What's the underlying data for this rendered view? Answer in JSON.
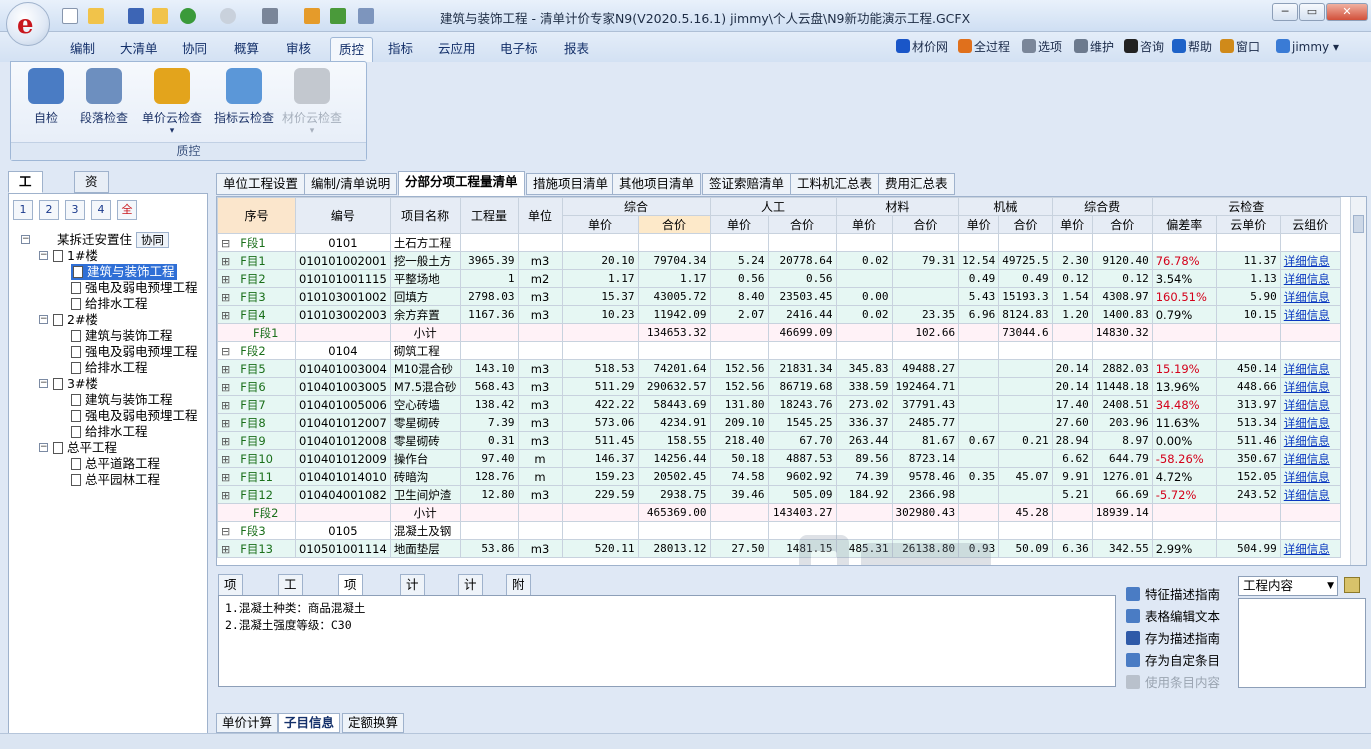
{
  "window": {
    "title": "建筑与装饰工程 - 清单计价专家N9(V2020.5.16.1) jimmy\\个人云盘\\N9新功能演示工程.GCFX",
    "logo_text": "e",
    "min": "─",
    "max": "▭",
    "close": "✕"
  },
  "menu": {
    "tabs": [
      "编制",
      "大清单",
      "协同",
      "概算",
      "审核",
      "质控",
      "指标",
      "云应用",
      "电子标",
      "报表"
    ],
    "active": "质控",
    "right_tools": [
      {
        "label": "材价网",
        "icon": "material-price-icon",
        "color": "#1a56c8"
      },
      {
        "label": "全过程",
        "icon": "full-process-icon",
        "color": "#e0701c"
      },
      {
        "label": "选项",
        "icon": "gear-icon",
        "color": "#7a8699"
      },
      {
        "label": "维护",
        "icon": "wrench-icon",
        "color": "#6c7a8e"
      },
      {
        "label": "咨询",
        "icon": "qq-icon",
        "color": "#222222"
      },
      {
        "label": "帮助",
        "icon": "help-icon",
        "color": "#1e62c8"
      },
      {
        "label": "窗口",
        "icon": "window-icon",
        "color": "#d08a1a"
      },
      {
        "label": "jimmy ▾",
        "icon": "user-icon",
        "color": "#3a7bd5"
      }
    ]
  },
  "ribbon": {
    "group": "质控",
    "buttons": [
      {
        "label": "自检",
        "icon": "target-icon",
        "color": "#4a7cc4",
        "disabled": false
      },
      {
        "label": "段落检查",
        "icon": "doc-check-icon",
        "color": "#6d8fbf",
        "disabled": false
      },
      {
        "label": "单价云检查",
        "icon": "yen-icon",
        "color": "#e3a41c",
        "disabled": false,
        "dropdown": "▾"
      },
      {
        "label": "指标云检查",
        "icon": "cloud-icon",
        "color": "#5b97d8",
        "disabled": false
      },
      {
        "label": "材价云检查",
        "icon": "bars-icon",
        "color": "#c3c8cf",
        "disabled": true,
        "dropdown": "▾"
      }
    ]
  },
  "left": {
    "tabs": [
      "工程树",
      "资料库"
    ],
    "levels": [
      "1",
      "2",
      "3",
      "4",
      "全"
    ],
    "root": {
      "label": "某拆迁安置住",
      "badge": "协同"
    },
    "tree": [
      {
        "label": "1#楼",
        "level": 1,
        "expanded": true
      },
      {
        "label": "建筑与装饰工程",
        "level": 2,
        "selected": true
      },
      {
        "label": "强电及弱电预埋工程",
        "level": 2
      },
      {
        "label": "给排水工程",
        "level": 2
      },
      {
        "label": "2#楼",
        "level": 1,
        "expanded": true
      },
      {
        "label": "建筑与装饰工程",
        "level": 2
      },
      {
        "label": "强电及弱电预埋工程",
        "level": 2
      },
      {
        "label": "给排水工程",
        "level": 2
      },
      {
        "label": "3#楼",
        "level": 1,
        "expanded": true
      },
      {
        "label": "建筑与装饰工程",
        "level": 2
      },
      {
        "label": "强电及弱电预埋工程",
        "level": 2
      },
      {
        "label": "给排水工程",
        "level": 2
      },
      {
        "label": "总平工程",
        "level": 1,
        "expanded": true
      },
      {
        "label": "总平道路工程",
        "level": 2
      },
      {
        "label": "总平园林工程",
        "level": 2
      }
    ]
  },
  "right_tabs": [
    "单位工程设置",
    "编制/清单说明",
    "分部分项工程量清单",
    "措施项目清单",
    "其他项目清单",
    "签证索赔清单",
    "工料机汇总表",
    "费用汇总表"
  ],
  "right_tab_active": "分部分项工程量清单",
  "grid": {
    "headers_top": [
      "序号",
      "编号",
      "项目名称",
      "工程量",
      "单位",
      "综合",
      "人工",
      "材料",
      "机械",
      "综合费",
      "云检查"
    ],
    "headers_sub": [
      "单价",
      "合价",
      "单价",
      "合价",
      "单价",
      "合价",
      "单价",
      "合价",
      "单价",
      "合价",
      "偏差率",
      "云单价",
      "云组价"
    ],
    "rows": [
      {
        "type": "part",
        "seq": "F段1",
        "code": "0101",
        "name": "土石方工程"
      },
      {
        "type": "itm",
        "seq": "F目1",
        "code": "010101002001",
        "name": "挖一般土方",
        "qty": "3965.39",
        "unit": "m3",
        "zh_dj": "20.10",
        "zh_hj": "79704.34",
        "rg_dj": "5.24",
        "rg_hj": "20778.64",
        "cl_dj": "0.02",
        "cl_hj": "79.31",
        "jx_dj": "12.54",
        "jx_hj": "49725.5",
        "zf_dj": "2.30",
        "zf_hj": "9120.40",
        "dev": "76.78%",
        "dev_red": true,
        "cloud": "11.37",
        "link": "详细信息"
      },
      {
        "type": "itm",
        "seq": "F目2",
        "code": "010101001115",
        "name": "平整场地",
        "qty": "1",
        "unit": "m2",
        "zh_dj": "1.17",
        "zh_hj": "1.17",
        "rg_dj": "0.56",
        "rg_hj": "0.56",
        "cl_dj": "",
        "cl_hj": "",
        "jx_dj": "0.49",
        "jx_hj": "0.49",
        "zf_dj": "0.12",
        "zf_hj": "0.12",
        "dev": "3.54%",
        "cloud": "1.13",
        "link": "详细信息"
      },
      {
        "type": "itm",
        "seq": "F目3",
        "code": "010103001002",
        "name": "回填方",
        "qty": "2798.03",
        "unit": "m3",
        "zh_dj": "15.37",
        "zh_hj": "43005.72",
        "rg_dj": "8.40",
        "rg_hj": "23503.45",
        "cl_dj": "0.00",
        "cl_hj": "",
        "jx_dj": "5.43",
        "jx_hj": "15193.3",
        "zf_dj": "1.54",
        "zf_hj": "4308.97",
        "dev": "160.51%",
        "dev_red": true,
        "cloud": "5.90",
        "link": "详细信息"
      },
      {
        "type": "itm",
        "seq": "F目4",
        "code": "010103002003",
        "name": "余方弃置",
        "qty": "1167.36",
        "unit": "m3",
        "zh_dj": "10.23",
        "zh_hj": "11942.09",
        "rg_dj": "2.07",
        "rg_hj": "2416.44",
        "cl_dj": "0.02",
        "cl_hj": "23.35",
        "jx_dj": "6.96",
        "jx_hj": "8124.83",
        "zf_dj": "1.20",
        "zf_hj": "1400.83",
        "dev": "0.79%",
        "cloud": "10.15",
        "link": "详细信息"
      },
      {
        "type": "sub",
        "seq": "F段1",
        "name": "小计",
        "zh_hj": "134653.32",
        "rg_hj": "46699.09",
        "cl_hj": "102.66",
        "jx_hj": "73044.6",
        "zf_hj": "14830.32"
      },
      {
        "type": "part",
        "seq": "F段2",
        "code": "0104",
        "name": "砌筑工程"
      },
      {
        "type": "itm",
        "seq": "F目5",
        "code": "010401003004",
        "name": "M10混合砂",
        "qty": "143.10",
        "unit": "m3",
        "zh_dj": "518.53",
        "zh_hj": "74201.64",
        "rg_dj": "152.56",
        "rg_hj": "21831.34",
        "cl_dj": "345.83",
        "cl_hj": "49488.27",
        "jx_dj": "",
        "jx_hj": "",
        "zf_dj": "20.14",
        "zf_hj": "2882.03",
        "dev": "15.19%",
        "dev_red": true,
        "cloud": "450.14",
        "link": "详细信息"
      },
      {
        "type": "itm",
        "seq": "F目6",
        "code": "010401003005",
        "name": "M7.5混合砂",
        "qty": "568.43",
        "unit": "m3",
        "zh_dj": "511.29",
        "zh_hj": "290632.57",
        "rg_dj": "152.56",
        "rg_hj": "86719.68",
        "cl_dj": "338.59",
        "cl_hj": "192464.71",
        "jx_dj": "",
        "jx_hj": "",
        "zf_dj": "20.14",
        "zf_hj": "11448.18",
        "dev": "13.96%",
        "cloud": "448.66",
        "link": "详细信息"
      },
      {
        "type": "itm",
        "seq": "F目7",
        "code": "010401005006",
        "name": "空心砖墙",
        "qty": "138.42",
        "unit": "m3",
        "zh_dj": "422.22",
        "zh_hj": "58443.69",
        "rg_dj": "131.80",
        "rg_hj": "18243.76",
        "cl_dj": "273.02",
        "cl_hj": "37791.43",
        "jx_dj": "",
        "jx_hj": "",
        "zf_dj": "17.40",
        "zf_hj": "2408.51",
        "dev": "34.48%",
        "dev_red": true,
        "cloud": "313.97",
        "link": "详细信息"
      },
      {
        "type": "itm",
        "seq": "F目8",
        "code": "010401012007",
        "name": "零星砌砖",
        "qty": "7.39",
        "unit": "m3",
        "zh_dj": "573.06",
        "zh_hj": "4234.91",
        "rg_dj": "209.10",
        "rg_hj": "1545.25",
        "cl_dj": "336.37",
        "cl_hj": "2485.77",
        "jx_dj": "",
        "jx_hj": "",
        "zf_dj": "27.60",
        "zf_hj": "203.96",
        "dev": "11.63%",
        "cloud": "513.34",
        "link": "详细信息"
      },
      {
        "type": "itm",
        "seq": "F目9",
        "code": "010401012008",
        "name": "零星砌砖",
        "qty": "0.31",
        "unit": "m3",
        "zh_dj": "511.45",
        "zh_hj": "158.55",
        "rg_dj": "218.40",
        "rg_hj": "67.70",
        "cl_dj": "263.44",
        "cl_hj": "81.67",
        "jx_dj": "0.67",
        "jx_hj": "0.21",
        "zf_dj": "28.94",
        "zf_hj": "8.97",
        "dev": "0.00%",
        "cloud": "511.46",
        "link": "详细信息"
      },
      {
        "type": "itm",
        "seq": "F目10",
        "code": "010401012009",
        "name": "操作台",
        "qty": "97.40",
        "unit": "m",
        "zh_dj": "146.37",
        "zh_hj": "14256.44",
        "rg_dj": "50.18",
        "rg_hj": "4887.53",
        "cl_dj": "89.56",
        "cl_hj": "8723.14",
        "jx_dj": "",
        "jx_hj": "",
        "zf_dj": "6.62",
        "zf_hj": "644.79",
        "dev": "-58.26%",
        "dev_red": true,
        "cloud": "350.67",
        "link": "详细信息"
      },
      {
        "type": "itm",
        "seq": "F目11",
        "code": "010401014010",
        "name": "砖暗沟",
        "qty": "128.76",
        "unit": "m",
        "zh_dj": "159.23",
        "zh_hj": "20502.45",
        "rg_dj": "74.58",
        "rg_hj": "9602.92",
        "cl_dj": "74.39",
        "cl_hj": "9578.46",
        "jx_dj": "0.35",
        "jx_hj": "45.07",
        "zf_dj": "9.91",
        "zf_hj": "1276.01",
        "dev": "4.72%",
        "cloud": "152.05",
        "link": "详细信息"
      },
      {
        "type": "itm",
        "seq": "F目12",
        "code": "010404001082",
        "name": "卫生间炉渣",
        "qty": "12.80",
        "unit": "m3",
        "zh_dj": "229.59",
        "zh_hj": "2938.75",
        "rg_dj": "39.46",
        "rg_hj": "505.09",
        "cl_dj": "184.92",
        "cl_hj": "2366.98",
        "jx_dj": "",
        "jx_hj": "",
        "zf_dj": "5.21",
        "zf_hj": "66.69",
        "dev": "-5.72%",
        "dev_red": true,
        "cloud": "243.52",
        "link": "详细信息"
      },
      {
        "type": "sub",
        "seq": "F段2",
        "name": "小计",
        "zh_hj": "465369.00",
        "rg_hj": "143403.27",
        "cl_hj": "302980.43",
        "jx_hj": "45.28",
        "zf_hj": "18939.14"
      },
      {
        "type": "part",
        "seq": "F段3",
        "code": "0105",
        "name": "混凝土及钢"
      },
      {
        "type": "itm",
        "seq": "F目13",
        "code": "010501001114",
        "name": "地面垫层",
        "qty": "53.86",
        "unit": "m3",
        "zh_dj": "520.11",
        "zh_hj": "28013.12",
        "rg_dj": "27.50",
        "rg_hj": "1481.15",
        "cl_dj": "485.31",
        "cl_hj": "26138.80",
        "jx_dj": "0.93",
        "jx_hj": "50.09",
        "zf_dj": "6.36",
        "zf_hj": "342.55",
        "dev": "2.99%",
        "cloud": "504.99",
        "link": "详细信息"
      }
    ]
  },
  "bottom": {
    "tabs": [
      "项目名称",
      "工程内容",
      "项目特征",
      "计算规则",
      "计算式",
      "附注"
    ],
    "active": "项目特征",
    "lines": [
      "1.混凝土种类：商品混凝土",
      "2.混凝土强度等级：C30"
    ],
    "actions": [
      {
        "label": "特征描述指南",
        "icon": "guide-icon",
        "disabled": false
      },
      {
        "label": "表格编辑文本",
        "icon": "table-icon",
        "disabled": false
      },
      {
        "label": "存为描述指南",
        "icon": "save-icon",
        "disabled": false
      },
      {
        "label": "存为自定条目",
        "icon": "save-custom-icon",
        "disabled": false
      },
      {
        "label": "使用条目内容",
        "icon": "use-entry-icon",
        "disabled": true
      }
    ],
    "select_value": "工程内容",
    "footer_tabs": [
      "单价计算",
      "子目信息",
      "定额换算"
    ],
    "footer_active": "子目信息"
  }
}
